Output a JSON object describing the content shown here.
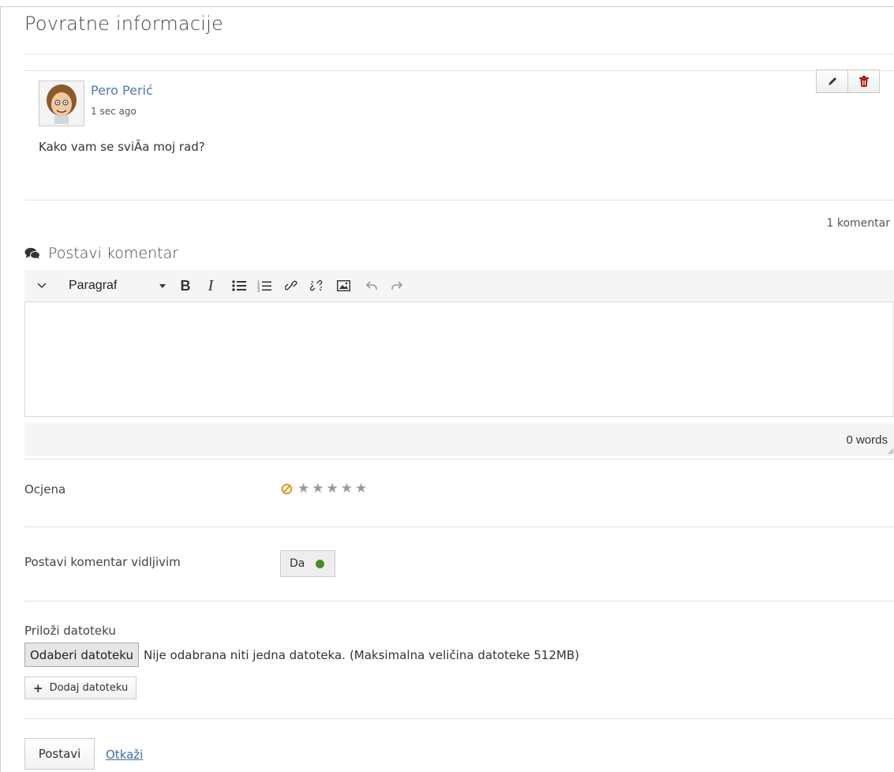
{
  "page": {
    "title": "Povratne informacije"
  },
  "post": {
    "author": "Pero Perić",
    "timestamp": "1 sec ago",
    "body": "Kako vam se sviĂa moj rad?"
  },
  "comments": {
    "count_label": "1 komentar"
  },
  "comment_form": {
    "heading": "Postavi komentar",
    "editor": {
      "paragraph_label": "Paragraf",
      "word_count": "0 words"
    },
    "rating": {
      "label": "Ocjena",
      "value": 0,
      "max": 5
    },
    "visibility": {
      "label": "Postavi komentar vidljivim",
      "toggle_label": "Da",
      "on_color": "#4e8a2c"
    },
    "attachments": {
      "label": "Priloži datoteku",
      "choose_button": "Odaberi datoteku",
      "status": "Nije odabrana niti jedna datoteka.",
      "max_size": "(Maksimalna veličina datoteke 512MB)",
      "add_button": "Dodaj datoteku"
    },
    "submit_label": "Postavi",
    "cancel_label": "Otkaži"
  },
  "icons": {
    "edit": "pencil-icon",
    "delete": "trash-icon",
    "comments": "comments-icon",
    "no_rating": "ban-icon",
    "star": "star-icon"
  },
  "colors": {
    "link": "#4a7ab5",
    "delete": "#b01e1e",
    "no_rating": "#d4a017"
  }
}
